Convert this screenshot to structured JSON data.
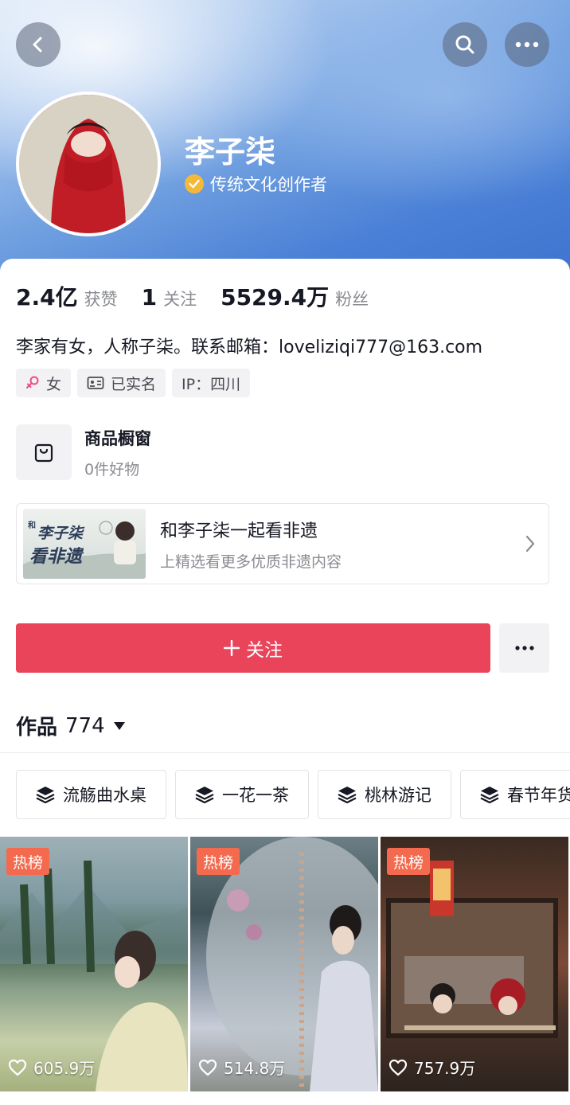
{
  "profile": {
    "name": "李子柒",
    "verification": "传统文化创作者"
  },
  "stats": {
    "likes_value": "2.4亿",
    "likes_label": "获赞",
    "following_value": "1",
    "following_label": "关注",
    "followers_value": "5529.4万",
    "followers_label": "粉丝"
  },
  "bio": "李家有女，人称子柒。联系邮箱：loveliziqi777@163.com",
  "tags": {
    "gender": "女",
    "real_name": "已实名",
    "ip": "IP：四川"
  },
  "shop": {
    "title": "商品橱窗",
    "subtitle": "0件好物"
  },
  "feature": {
    "title": "和李子柒一起看非遗",
    "subtitle": "上精选看更多优质非遗内容",
    "thumb_text_1": "李子柒",
    "thumb_text_2": "看非遗",
    "thumb_prefix": "和"
  },
  "actions": {
    "follow_label": "关注"
  },
  "works": {
    "label": "作品",
    "count": "774"
  },
  "collections": [
    {
      "label": "流觞曲水桌"
    },
    {
      "label": "一花一茶"
    },
    {
      "label": "桃林游记"
    },
    {
      "label": "春节年货"
    }
  ],
  "videos": [
    {
      "badge": "热榜",
      "likes": "605.9万"
    },
    {
      "badge": "热榜",
      "likes": "514.8万"
    },
    {
      "badge": "热榜",
      "likes": "757.9万"
    }
  ],
  "colors": {
    "follow_button": "#e9445a",
    "hot_badge": "#f46a4e",
    "verify_badge": "#f5b93a"
  }
}
